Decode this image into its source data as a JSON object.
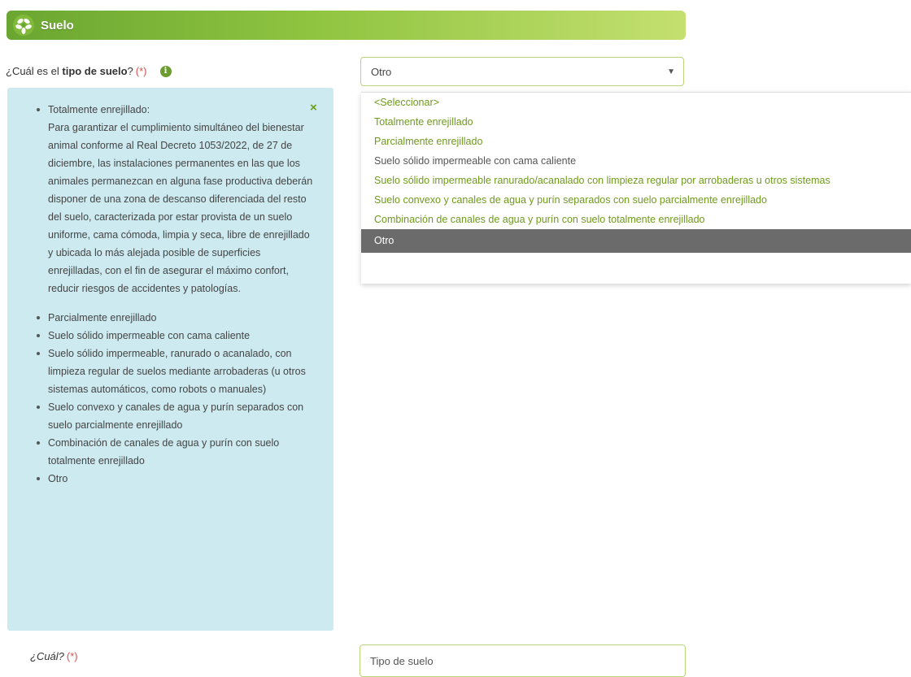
{
  "section": {
    "title": "Suelo",
    "icon": "leaf-cluster-icon",
    "colors": {
      "bar_start": "#6aa631",
      "bar_end": "#c4e070"
    }
  },
  "question": {
    "prefix": "¿Cuál es el ",
    "bold": "tipo de suelo",
    "suffix": "?",
    "required": "(*)",
    "info_icon": "i"
  },
  "select": {
    "value": "Otro",
    "options": [
      {
        "label": "<Seleccionar>",
        "style": "green"
      },
      {
        "label": "Totalmente enrejillado",
        "style": "green"
      },
      {
        "label": "Parcialmente enrejillado",
        "style": "green"
      },
      {
        "label": "Suelo sólido impermeable con cama caliente",
        "style": "gray"
      },
      {
        "label": "Suelo sólido impermeable ranurado/acanalado con limpieza regular por arrobaderas u otros sistemas",
        "style": "green"
      },
      {
        "label": "Suelo convexo y canales de agua y purín separados con suelo parcialmente enrejillado",
        "style": "green"
      },
      {
        "label": "Combinación de canales de agua y purín con suelo totalmente enrejillado",
        "style": "green"
      },
      {
        "label": "Otro",
        "style": "selected"
      }
    ]
  },
  "help": {
    "close": "×",
    "items": [
      {
        "title": "Totalmente enrejillado:",
        "desc": "Para garantizar el cumplimiento simultáneo del bienestar animal conforme al Real Decreto 1053/2022, de 27 de diciembre, las instalaciones permanentes en las que los animales permanezcan en alguna fase productiva deberán disponer de una zona de descanso diferenciada del resto del suelo, caracterizada por estar provista de un suelo uniforme, cama cómoda, limpia y seca, libre de enrejillado y ubicada lo más alejada posible de superficies enrejilladas, con el fin de asegurar el máximo confort, reducir riesgos de accidentes y patologías."
      },
      {
        "title": "Parcialmente enrejillado"
      },
      {
        "title": "Suelo sólido impermeable con cama caliente"
      },
      {
        "title": "Suelo sólido impermeable, ranurado o acanalado, con limpieza regular de suelos mediante arrobaderas (u otros sistemas automáticos, como robots o manuales)"
      },
      {
        "title": "Suelo convexo y canales de agua y purín separados con suelo parcialmente enrejillado"
      },
      {
        "title": "Combinación de canales de agua y purín con suelo totalmente enrejillado"
      },
      {
        "title": "Otro"
      }
    ]
  },
  "cual": {
    "label": "¿Cuál?",
    "required": "(*)",
    "placeholder": "Tipo de suelo"
  }
}
